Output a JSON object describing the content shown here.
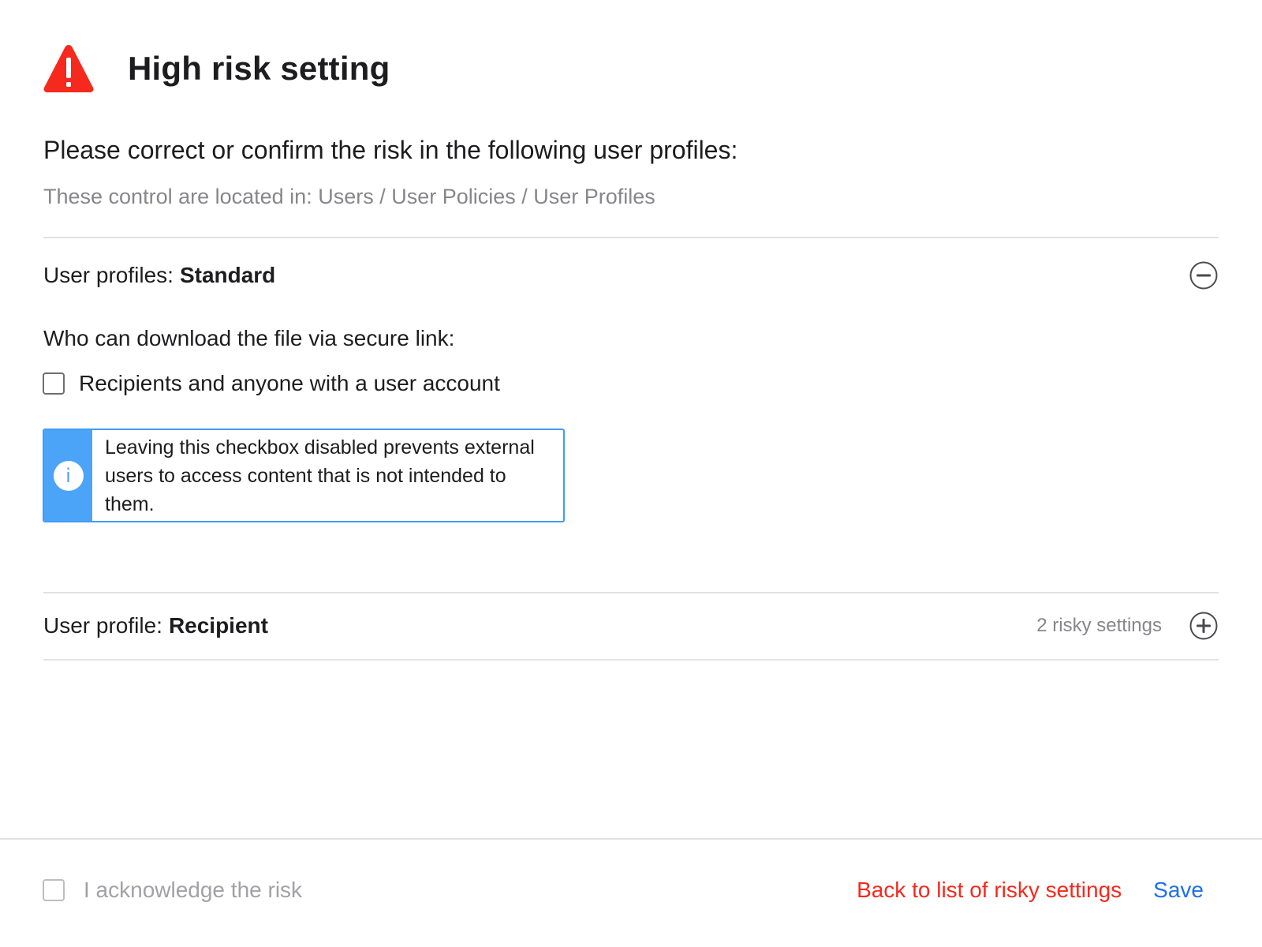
{
  "header": {
    "title": "High risk setting",
    "icon": "warning-triangle-icon",
    "icon_color": "#f5291d"
  },
  "intro": {
    "subtitle": "Please correct or confirm the risk in the following user profiles:",
    "location": "These control are located in: Users / User Policies / User Profiles"
  },
  "profiles": [
    {
      "label": "User profiles:",
      "name": "Standard",
      "expanded": true,
      "toggle_icon": "collapse-minus-icon",
      "setting": {
        "question": "Who can download the file via secure link:",
        "option_label": "Recipients and anyone with a user account",
        "checked": false,
        "info": "Leaving this checkbox disabled prevents external users to access content that is not intended to them.",
        "info_icon": "info-icon",
        "info_color": "#4ba4f7"
      }
    },
    {
      "label": "User profile:",
      "name": "Recipient",
      "expanded": false,
      "risky_count": "2 risky settings",
      "toggle_icon": "expand-plus-icon"
    }
  ],
  "footer": {
    "acknowledge_label": "I acknowledge the risk",
    "acknowledged": false,
    "back_label": "Back to list of risky settings",
    "back_color": "#f5291d",
    "save_label": "Save",
    "save_color": "#1f6ff0"
  }
}
